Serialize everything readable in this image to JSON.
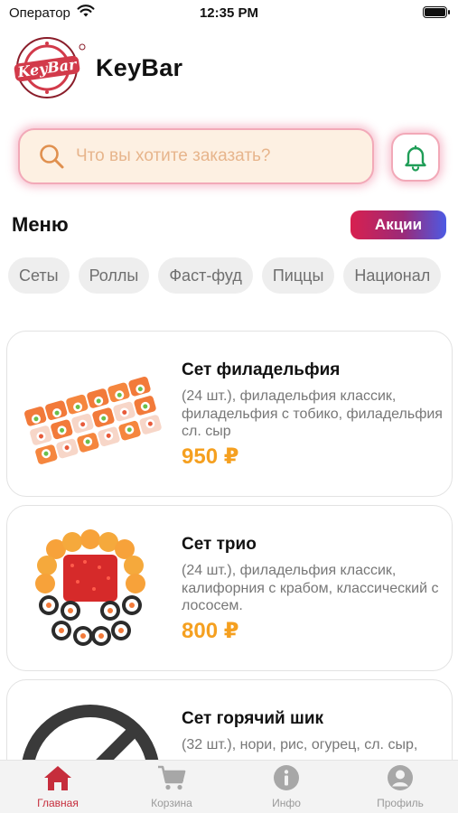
{
  "status_bar": {
    "carrier": "Оператор",
    "time": "12:35 PM"
  },
  "app": {
    "title": "KeyBar"
  },
  "search": {
    "placeholder": "Что вы хотите заказать?"
  },
  "menu": {
    "title": "Меню",
    "promo_label": "Акции"
  },
  "categories": [
    "Сеты",
    "Роллы",
    "Фаст-фуд",
    "Пиццы",
    "Национал"
  ],
  "products": [
    {
      "name": "Сет филадельфия",
      "description": "(24 шт.), филадельфия классик, филадельфия с тобико, филадельфия сл. сыр",
      "price": "950 ₽"
    },
    {
      "name": "Сет трио",
      "description": "(24 шт.), филадельфия классик, калифорния с крабом, классический с лососем.",
      "price": "800 ₽"
    },
    {
      "name": "Сет горячий шик",
      "description": "(32 шт.), нори, рис, огурец, сл. сыр,",
      "price": ""
    }
  ],
  "tabs": [
    {
      "label": "Главная",
      "icon": "home-icon",
      "active": true
    },
    {
      "label": "Корзина",
      "icon": "cart-icon",
      "active": false
    },
    {
      "label": "Инфо",
      "icon": "info-icon",
      "active": false
    },
    {
      "label": "Профиль",
      "icon": "profile-icon",
      "active": false
    }
  ],
  "colors": {
    "accent": "#c62d3c",
    "price": "#f5a020",
    "search_bg": "#fdf0e2",
    "bell": "#1f9d57"
  }
}
